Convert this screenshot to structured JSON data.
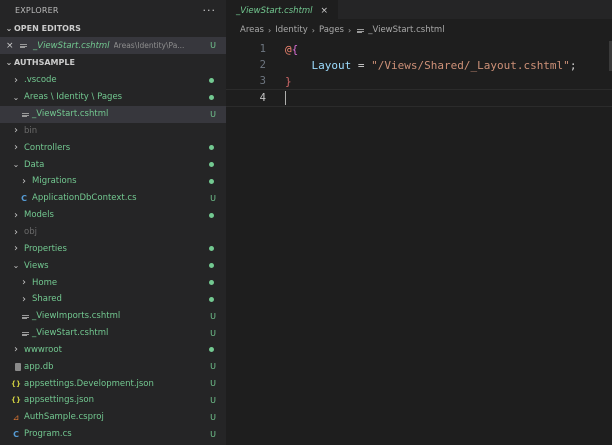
{
  "explorer": {
    "title": "EXPLORER",
    "more": "···"
  },
  "open_editors": {
    "title": "OPEN EDITORS",
    "items": [
      {
        "name": "_ViewStart.cshtml",
        "path": "Areas\\Identity\\Pa...",
        "status": "U"
      }
    ]
  },
  "project": {
    "title": "AUTHSAMPLE",
    "tree": [
      {
        "name": ".vscode",
        "indent": 0,
        "kind": "folder",
        "expanded": false,
        "mark": "dot"
      },
      {
        "name": "Areas \\ Identity \\ Pages",
        "indent": 0,
        "kind": "folder",
        "expanded": true,
        "mark": "dot"
      },
      {
        "name": "_ViewStart.cshtml",
        "indent": 1,
        "kind": "file",
        "mark": "U",
        "selected": true
      },
      {
        "name": "bin",
        "indent": 0,
        "kind": "folder",
        "expanded": false,
        "dim": true
      },
      {
        "name": "Controllers",
        "indent": 0,
        "kind": "folder",
        "expanded": false,
        "mark": "dot"
      },
      {
        "name": "Data",
        "indent": 0,
        "kind": "folder",
        "expanded": true,
        "mark": "dot"
      },
      {
        "name": "Migrations",
        "indent": 1,
        "kind": "folder",
        "expanded": false,
        "mark": "dot"
      },
      {
        "name": "ApplicationDbContext.cs",
        "indent": 1,
        "kind": "cs",
        "mark": "U"
      },
      {
        "name": "Models",
        "indent": 0,
        "kind": "folder",
        "expanded": false,
        "mark": "dot"
      },
      {
        "name": "obj",
        "indent": 0,
        "kind": "folder",
        "expanded": false,
        "dim": true
      },
      {
        "name": "Properties",
        "indent": 0,
        "kind": "folder",
        "expanded": false,
        "mark": "dot"
      },
      {
        "name": "Views",
        "indent": 0,
        "kind": "folder",
        "expanded": true,
        "mark": "dot"
      },
      {
        "name": "Home",
        "indent": 1,
        "kind": "folder",
        "expanded": false,
        "mark": "dot"
      },
      {
        "name": "Shared",
        "indent": 1,
        "kind": "folder",
        "expanded": false,
        "mark": "dot"
      },
      {
        "name": "_ViewImports.cshtml",
        "indent": 1,
        "kind": "file",
        "mark": "U"
      },
      {
        "name": "_ViewStart.cshtml",
        "indent": 1,
        "kind": "file",
        "mark": "U"
      },
      {
        "name": "wwwroot",
        "indent": 0,
        "kind": "folder",
        "expanded": false,
        "mark": "dot"
      },
      {
        "name": "app.db",
        "indent": 0,
        "kind": "db",
        "mark": "U"
      },
      {
        "name": "appsettings.Development.json",
        "indent": 0,
        "kind": "json",
        "mark": "U"
      },
      {
        "name": "appsettings.json",
        "indent": 0,
        "kind": "json",
        "mark": "U"
      },
      {
        "name": "AuthSample.csproj",
        "indent": 0,
        "kind": "rss",
        "mark": "U"
      },
      {
        "name": "Program.cs",
        "indent": 0,
        "kind": "cs",
        "mark": "U"
      }
    ]
  },
  "tab": {
    "label": "_ViewStart.cshtml",
    "close": "×"
  },
  "breadcrumb": [
    "Areas",
    "Identity",
    "Pages",
    "_ViewStart.cshtml"
  ],
  "code": {
    "lines": [
      {
        "n": "1",
        "tokens": [
          [
            "razor",
            "@"
          ],
          [
            "brace",
            "{"
          ]
        ]
      },
      {
        "n": "2",
        "tokens": [
          [
            "op",
            "    "
          ],
          [
            "ident",
            "Layout"
          ],
          [
            "op",
            " = "
          ],
          [
            "str",
            "\"/Views/Shared/_Layout.cshtml\""
          ],
          [
            "op",
            ";"
          ]
        ]
      },
      {
        "n": "3",
        "tokens": [
          [
            "brace2",
            "}"
          ]
        ]
      },
      {
        "n": "4",
        "tokens": [],
        "cursor": true
      }
    ]
  },
  "colors": {
    "untracked": "#73c991",
    "background": "#1e1e1e",
    "sidebar": "#252526"
  }
}
